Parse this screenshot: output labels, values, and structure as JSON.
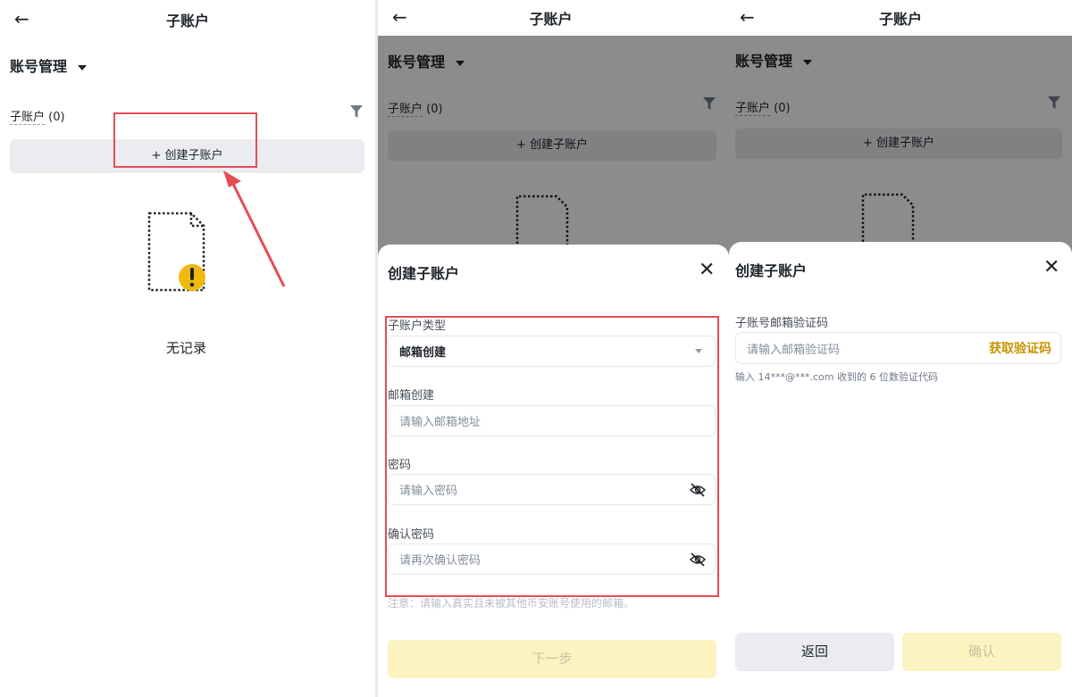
{
  "screen1": {
    "title": "子账户",
    "section": "账号管理",
    "sub_label": "子账户",
    "sub_count": "(0)",
    "create_button": "+ 创建子账户",
    "empty_text": "无记录"
  },
  "screen2": {
    "title": "子账户",
    "section": "账号管理",
    "sub_label": "子账户",
    "sub_count": "(0)",
    "create_button": "+ 创建子账户",
    "sheet": {
      "title": "创建子账户",
      "type_label": "子账户类型",
      "type_value": "邮箱创建",
      "email_label": "邮箱创建",
      "email_placeholder": "请输入邮箱地址",
      "password_label": "密码",
      "password_placeholder": "请输入密码",
      "confirm_label": "确认密码",
      "confirm_placeholder": "请再次确认密码",
      "note": "注意：请输入真实且未被其他币安账号使用的邮箱。",
      "next_button": "下一步"
    }
  },
  "screen3": {
    "title": "子账户",
    "section": "账号管理",
    "sub_label": "子账户",
    "sub_count": "(0)",
    "create_button": "+ 创建子账户",
    "sheet": {
      "title": "创建子账户",
      "code_label": "子账号邮箱验证码",
      "code_placeholder": "请输入邮箱验证码",
      "get_code": "获取验证码",
      "hint": "输入 14***@***.com 收到的 6 位数验证代码",
      "back_button": "返回",
      "confirm_button": "确认"
    }
  },
  "colors": {
    "accent": "#f0b90b",
    "highlight": "#e64b55",
    "muted_button": "#eaecef",
    "disabled_primary": "#fdf3c1"
  },
  "icons": [
    "back-arrow-icon",
    "caret-down-icon",
    "filter-icon",
    "empty-document-icon",
    "warning-icon",
    "close-icon",
    "eye-off-icon"
  ]
}
